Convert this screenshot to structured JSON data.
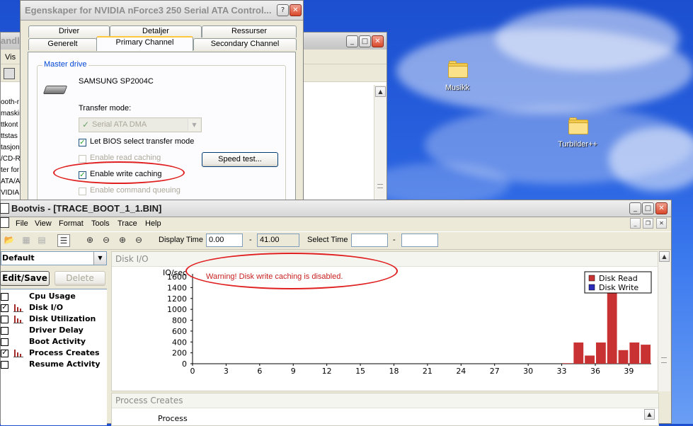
{
  "desktop": {
    "icons": [
      {
        "label": "Musikk",
        "icon": "folder-icon"
      },
      {
        "label": "Turbilder++",
        "icon": "folder-icon"
      }
    ]
  },
  "background_window": {
    "partial_title": "andl",
    "menu_item": "Vis",
    "tree_items": [
      "ooth-r",
      "maskin",
      "ttkont",
      "ttstas",
      "tasjon",
      "/CD-R",
      "ter for",
      "ATA/AT",
      "VIDIA"
    ]
  },
  "dialog": {
    "title": "Egenskaper for NVIDIA nForce3 250 Serial ATA Control...",
    "tabs_row1": [
      "Driver",
      "Detaljer",
      "Ressurser"
    ],
    "tabs_row2": [
      "Generelt",
      "Primary Channel",
      "Secondary Channel"
    ],
    "active_tab": "Primary Channel",
    "group_title": "Master drive",
    "drive_name": "SAMSUNG SP2004C",
    "transfer_mode_label": "Transfer mode:",
    "transfer_mode_value": "Serial ATA DMA",
    "options": [
      {
        "label": "Let BIOS select transfer mode",
        "checked": true,
        "enabled": true
      },
      {
        "label": "Enable read caching",
        "checked": false,
        "enabled": false
      },
      {
        "label": "Enable write caching",
        "checked": true,
        "enabled": true
      },
      {
        "label": "Enable command queuing",
        "checked": false,
        "enabled": false
      }
    ],
    "speed_test_button": "Speed test..."
  },
  "bootvis": {
    "title": "Bootvis - [TRACE_BOOT_1_1.BIN]",
    "menu": [
      "File",
      "View",
      "Format",
      "Tools",
      "Trace",
      "Help"
    ],
    "display_time_label": "Display Time",
    "display_time_from": "0.00",
    "display_time_to": "41.00",
    "select_time_label": "Select Time",
    "select_time_from": "",
    "select_time_to": "",
    "dash": "-",
    "preset": "Default",
    "edit_save_button": "Edit/Save",
    "delete_button": "Delete",
    "graph_list": [
      {
        "label": "Cpu Usage",
        "checked": false,
        "has_bars_icon": false
      },
      {
        "label": "Disk I/O",
        "checked": true,
        "has_bars_icon": true
      },
      {
        "label": "Disk Utilization",
        "checked": false,
        "has_bars_icon": true
      },
      {
        "label": "Driver Delay",
        "checked": false,
        "has_bars_icon": false
      },
      {
        "label": "Boot Activity",
        "checked": false,
        "has_bars_icon": false
      },
      {
        "label": "Process Creates",
        "checked": true,
        "has_bars_icon": true
      },
      {
        "label": "Resume Activity",
        "checked": false,
        "has_bars_icon": false
      }
    ],
    "disk_io_header": "Disk I/O",
    "warning": "Warning!  Disk write caching is disabled.",
    "process_creates_header": "Process Creates",
    "process_column": "Process"
  },
  "chart_data": {
    "type": "bar",
    "ylabel": "IO/sec",
    "yticks": [
      0,
      200,
      400,
      600,
      800,
      1000,
      1200,
      1400,
      1600
    ],
    "xticks": [
      0,
      3,
      6,
      9,
      12,
      15,
      18,
      21,
      24,
      27,
      30,
      33,
      36,
      39
    ],
    "xlim": [
      0,
      41
    ],
    "ylim": [
      0,
      1600
    ],
    "legend_position": "top-right",
    "series": [
      {
        "name": "Disk Read",
        "color": "#c83232",
        "x": [
          33,
          34,
          35,
          36,
          37,
          38,
          39,
          40
        ],
        "values": [
          10,
          390,
          150,
          390,
          1520,
          250,
          390,
          350
        ]
      },
      {
        "name": "Disk Write",
        "color": "#2b2bb8",
        "x": [],
        "values": []
      }
    ]
  },
  "colors": {
    "annotation": "#e02020",
    "warning_text": "#c81e1e",
    "group_title": "#0046d5"
  }
}
